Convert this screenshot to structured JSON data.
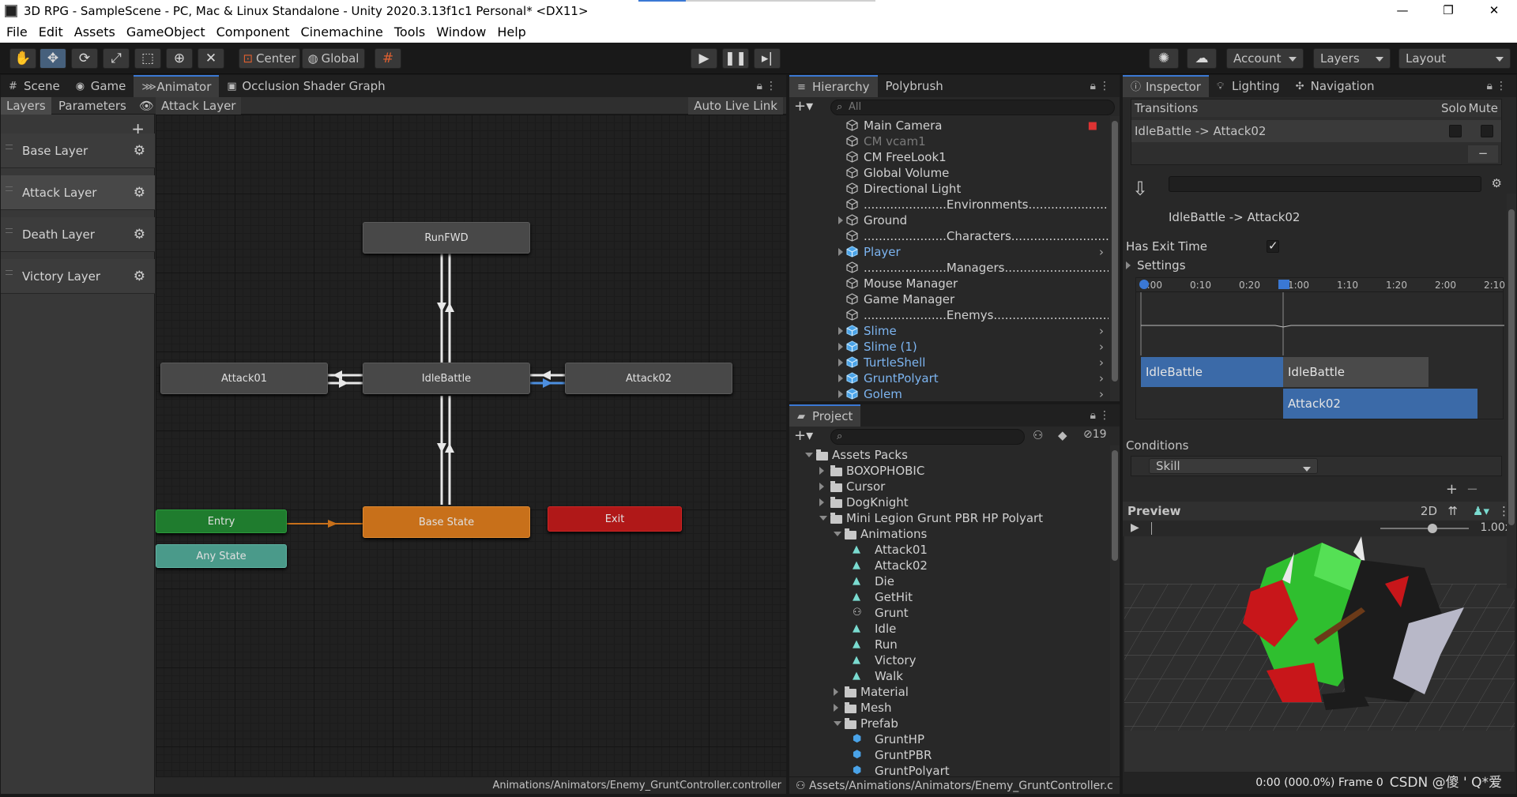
{
  "window": {
    "title": "3D RPG - SampleScene - PC, Mac & Linux Standalone - Unity 2020.3.13f1c1 Personal* <DX11>",
    "controls": [
      "—",
      "❐",
      "✕"
    ]
  },
  "menu": [
    "File",
    "Edit",
    "Assets",
    "GameObject",
    "Component",
    "Cinemachine",
    "Tools",
    "Window",
    "Help"
  ],
  "toolbar": {
    "pivot": "Center",
    "space": "Global",
    "account": "Account",
    "layers": "Layers",
    "layout": "Layout"
  },
  "animator": {
    "tabs": [
      "Scene",
      "Game",
      "Animator",
      "Occlusion Shader Graph"
    ],
    "sub_tabs": [
      "Layers",
      "Parameters"
    ],
    "breadcrumb": "Attack Layer",
    "auto_live_link": "Auto Live Link",
    "layers": [
      "Base Layer",
      "Attack Layer",
      "Death Layer",
      "Victory Layer"
    ],
    "selected_layer": "Attack Layer",
    "states": {
      "runfwd": "RunFWD",
      "attack01": "Attack01",
      "idlebattle": "IdleBattle",
      "attack02": "Attack02",
      "entry": "Entry",
      "any_state": "Any State",
      "base_state": "Base State",
      "exit": "Exit"
    },
    "status_path": "Animations/Animators/Enemy_GruntController.controller"
  },
  "hierarchy": {
    "tabs": [
      "Hierarchy",
      "Polybrush"
    ],
    "search_placeholder": "All",
    "items": [
      {
        "label": "Main Camera",
        "style": "normal",
        "fold": false,
        "chevron": false
      },
      {
        "label": "CM vcam1",
        "style": "dim",
        "fold": false,
        "chevron": false
      },
      {
        "label": "CM FreeLook1",
        "style": "normal",
        "fold": false,
        "chevron": false
      },
      {
        "label": "Global Volume",
        "style": "normal",
        "fold": false,
        "chevron": false
      },
      {
        "label": "Directional Light",
        "style": "normal",
        "fold": false,
        "chevron": false
      },
      {
        "label": "......................Environments..............................",
        "style": "normal",
        "fold": false,
        "chevron": false
      },
      {
        "label": "Ground",
        "style": "normal",
        "fold": true,
        "chevron": false
      },
      {
        "label": "......................Characters...............................",
        "style": "normal",
        "fold": false,
        "chevron": false
      },
      {
        "label": "Player",
        "style": "blue",
        "fold": true,
        "chevron": true
      },
      {
        "label": "......................Managers.................................",
        "style": "normal",
        "fold": false,
        "chevron": false
      },
      {
        "label": "Mouse Manager",
        "style": "normal",
        "fold": false,
        "chevron": false
      },
      {
        "label": "Game Manager",
        "style": "normal",
        "fold": false,
        "chevron": false
      },
      {
        "label": "......................Enemys...............................",
        "style": "normal",
        "fold": false,
        "chevron": false
      },
      {
        "label": "Slime",
        "style": "blue",
        "fold": true,
        "chevron": true
      },
      {
        "label": "Slime (1)",
        "style": "blue",
        "fold": true,
        "chevron": true
      },
      {
        "label": "TurtleShell",
        "style": "blue",
        "fold": true,
        "chevron": true
      },
      {
        "label": "GruntPolyart",
        "style": "blue",
        "fold": true,
        "chevron": true
      },
      {
        "label": "Golem",
        "style": "blue",
        "fold": true,
        "chevron": true
      }
    ]
  },
  "project": {
    "tab": "Project",
    "hidden_count": "19",
    "items": [
      {
        "label": "Assets Packs",
        "kind": "folder",
        "depth": 0,
        "open": true
      },
      {
        "label": "BOXOPHOBIC",
        "kind": "folder",
        "depth": 1,
        "open": false
      },
      {
        "label": "Cursor",
        "kind": "folder",
        "depth": 1,
        "open": false
      },
      {
        "label": "DogKnight",
        "kind": "folder",
        "depth": 1,
        "open": false
      },
      {
        "label": "Mini Legion Grunt PBR HP Polyart",
        "kind": "folder",
        "depth": 1,
        "open": true
      },
      {
        "label": "Animations",
        "kind": "folder",
        "depth": 2,
        "open": true
      },
      {
        "label": "Attack01",
        "kind": "anim",
        "depth": 3
      },
      {
        "label": "Attack02",
        "kind": "anim",
        "depth": 3
      },
      {
        "label": "Die",
        "kind": "anim",
        "depth": 3
      },
      {
        "label": "GetHit",
        "kind": "anim",
        "depth": 3
      },
      {
        "label": "Grunt",
        "kind": "controller",
        "depth": 3
      },
      {
        "label": "Idle",
        "kind": "anim",
        "depth": 3
      },
      {
        "label": "Run",
        "kind": "anim",
        "depth": 3
      },
      {
        "label": "Victory",
        "kind": "anim",
        "depth": 3
      },
      {
        "label": "Walk",
        "kind": "anim",
        "depth": 3
      },
      {
        "label": "Material",
        "kind": "folder",
        "depth": 2,
        "open": false
      },
      {
        "label": "Mesh",
        "kind": "folder",
        "depth": 2,
        "open": false
      },
      {
        "label": "Prefab",
        "kind": "folder",
        "depth": 2,
        "open": true
      },
      {
        "label": "GruntHP",
        "kind": "prefab",
        "depth": 3
      },
      {
        "label": "GruntPBR",
        "kind": "prefab",
        "depth": 3
      },
      {
        "label": "GruntPolyart",
        "kind": "prefab",
        "depth": 3
      }
    ],
    "status_path": "Assets/Animations/Animators/Enemy_GruntController.c"
  },
  "inspector": {
    "tabs": [
      "Inspector",
      "Lighting",
      "Navigation"
    ],
    "transitions_label": "Transitions",
    "solo": "Solo",
    "mute": "Mute",
    "transition_item": "IdleBattle -> Attack02",
    "transition_name": "IdleBattle -> Attack02",
    "has_exit_time_label": "Has Exit Time",
    "has_exit_time": true,
    "settings_label": "Settings",
    "timeline_ticks": [
      "0:00",
      "0:10",
      "0:20",
      "1:00",
      "1:10",
      "1:20",
      "2:00",
      "2:10"
    ],
    "tl_from": "IdleBattle",
    "tl_from2": "IdleBattle",
    "tl_to": "Attack02",
    "conditions_label": "Conditions",
    "condition_param": "Skill",
    "preview_label": "Preview",
    "preview_2d": "2D",
    "preview_speed": "1.00x",
    "preview_frame": "0:00 (000.0%) Frame 0",
    "watermark": "CSDN @傻 ' Q*爱"
  }
}
